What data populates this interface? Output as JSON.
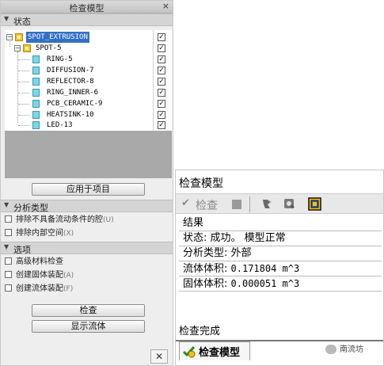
{
  "panel": {
    "title": "检查模型",
    "close_glyph": "×"
  },
  "status_section": {
    "label": "状态"
  },
  "tree": {
    "root": {
      "label": "SPOT_EXTRUSION",
      "checked": true,
      "expander": "−"
    },
    "child": {
      "label": "SPOT-5",
      "checked": true,
      "expander": "−"
    },
    "parts": [
      {
        "label": "RING-5"
      },
      {
        "label": "DIFFUSION-7"
      },
      {
        "label": "REFLECTOR-8"
      },
      {
        "label": "RING_INNER-6"
      },
      {
        "label": "PCB_CERAMIC-9"
      },
      {
        "label": "HEATSINK-10"
      },
      {
        "label": "LED-13"
      }
    ],
    "check_glyph": "✓"
  },
  "apply_button": "应用于项目",
  "analysis_section": {
    "label": "分析类型",
    "options": [
      {
        "label": "排除不具备流动条件的腔",
        "hint": "(U)"
      },
      {
        "label": "排除内部空间",
        "hint": "(X)"
      }
    ]
  },
  "options_section": {
    "label": "选项",
    "options": [
      {
        "label": "高级材料检查",
        "hint": ""
      },
      {
        "label": "创建固体装配",
        "hint": "(A)"
      },
      {
        "label": "创建流体装配",
        "hint": "(F)"
      }
    ]
  },
  "check_button": "检查",
  "show_fluid_button": "显示流体",
  "bottom_close_glyph": "✕",
  "window": {
    "title": "检查模型",
    "toolbar": {
      "check_label": "检查",
      "check_glyph": "✔"
    },
    "results": {
      "heading": "结果",
      "status_line": "状态: 成功。 模型正常",
      "analysis_line": "分析类型: 外部",
      "fluid_volume_label": "流体体积: ",
      "fluid_volume_value": "0.171804 m^3",
      "solid_volume_label": "固体体积: ",
      "solid_volume_value": "0.000051 m^3"
    },
    "status_bar": "检查完成",
    "tab_label": "检查模型"
  },
  "watermark": "南流坊",
  "colors": {
    "selection": "#3270c8",
    "tree_background": "#a9a9a9",
    "assembly_icon": "#f2c230",
    "part_icon": "#7ad6e8"
  }
}
